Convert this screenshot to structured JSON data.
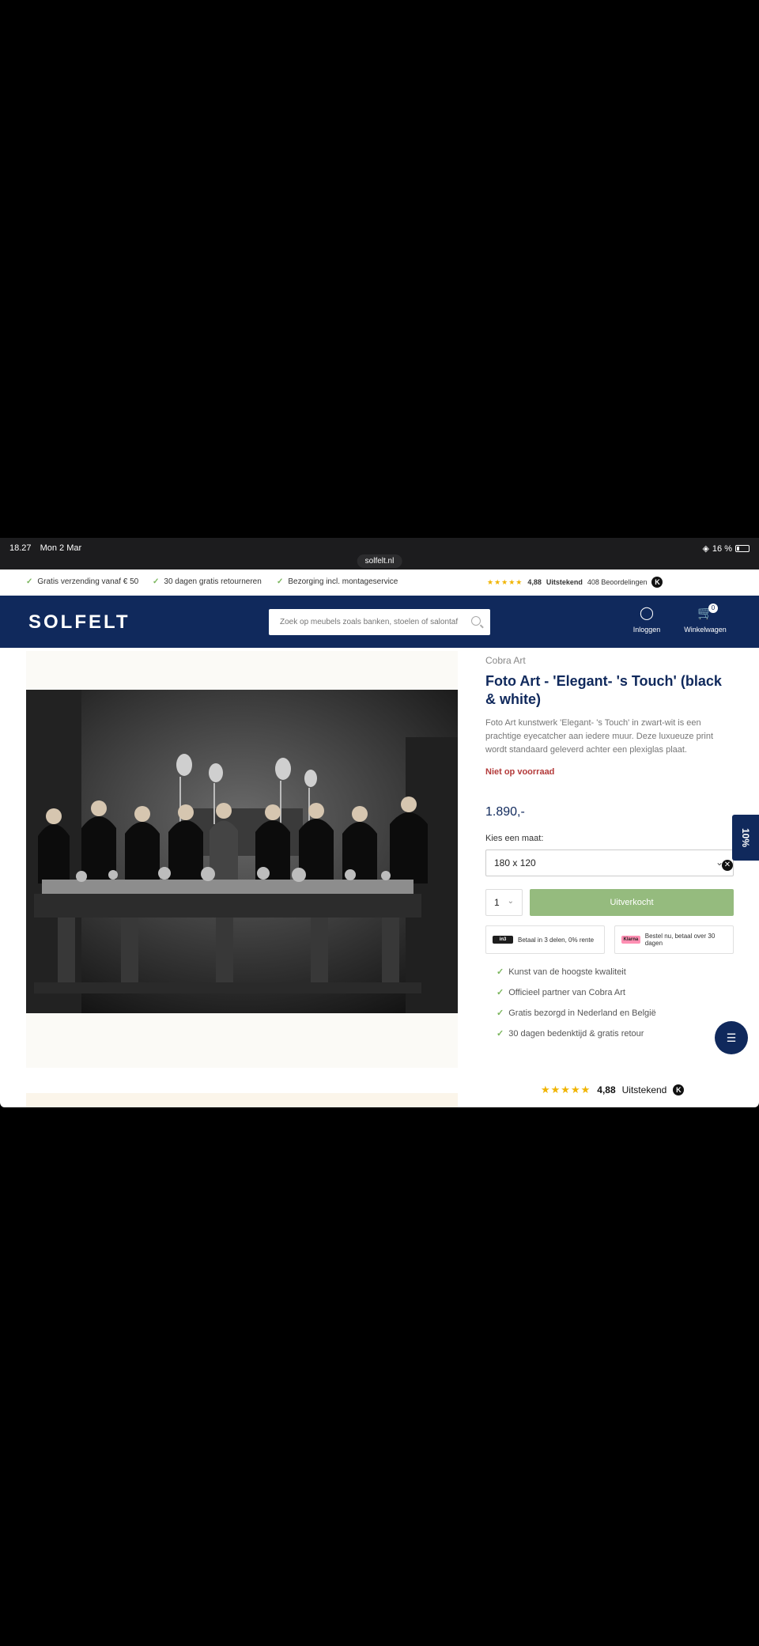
{
  "status": {
    "time": "18.27",
    "date": "Mon 2 Mar",
    "battery": "16 %",
    "url": "solfelt.nl"
  },
  "usp": {
    "items": [
      "Gratis verzending vanaf € 50",
      "30 dagen gratis retourneren",
      "Bezorging incl. montageservice"
    ],
    "rating_stars": "★★★★★",
    "rating_score": "4,88",
    "rating_label": "Uitstekend",
    "rating_count": "408 Beoordelingen",
    "kiyoh_icon": "K"
  },
  "header": {
    "logo": "SOLFELT",
    "search_placeholder": "Zoek op meubels zoals banken, stoelen of salontaf",
    "login_label": "Inloggen",
    "cart_label": "Winkelwagen",
    "cart_count": "0"
  },
  "product": {
    "brand": "Cobra Art",
    "title": "Foto Art - 'Elegant- 's Touch' (black & white)",
    "description": "Foto Art kunstwerk 'Elegant- 's Touch' in zwart-wit is een prachtige eyecatcher aan iedere muur. Deze luxueuze print wordt standaard geleverd achter een plexiglas plaat.",
    "stock_status": "Niet op voorraad",
    "price": "1.890,-",
    "size_label": "Kies een maat:",
    "size_value": "180 x 120",
    "quantity": "1",
    "buy_label": "Uitverkocht",
    "pay_in3": "Betaal in 3 delen, 0% rente",
    "pay_klarna": "Bestel nu, betaal over 30 dagen",
    "pay_in3_logo": "in3",
    "pay_klarna_logo": "Klarna",
    "usps": [
      "Kunst van de hoogste kwaliteit",
      "Officieel partner van Cobra Art",
      "Gratis bezorgd in Nederland en België",
      "30 dagen bedenktijd & gratis retour"
    ]
  },
  "bottom_rating": {
    "stars": "★★★★★",
    "score": "4,88",
    "label": "Uitstekend"
  },
  "discount_tab": "10%",
  "colors": {
    "navy": "#10295c",
    "green": "#95bb7e",
    "stock_red": "#b33a3a",
    "star": "#f0b400"
  }
}
